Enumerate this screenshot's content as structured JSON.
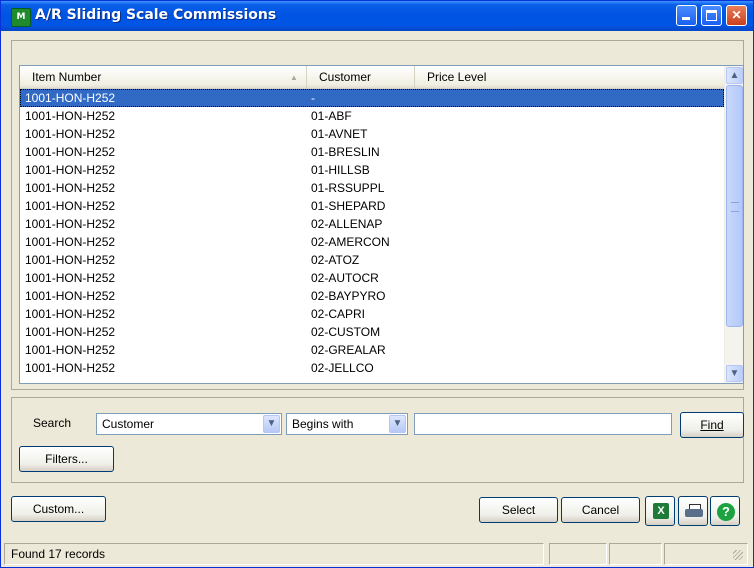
{
  "window": {
    "title": "A/R Sliding Scale Commissions",
    "icon": "mas90-app-icon"
  },
  "grid": {
    "columns": [
      "Item Number",
      "Customer",
      "Price Level"
    ],
    "rows": [
      {
        "item": "1001-HON-H252",
        "customer": "-",
        "selected": true
      },
      {
        "item": "1001-HON-H252",
        "customer": "01-ABF"
      },
      {
        "item": "1001-HON-H252",
        "customer": "01-AVNET"
      },
      {
        "item": "1001-HON-H252",
        "customer": "01-BRESLIN"
      },
      {
        "item": "1001-HON-H252",
        "customer": "01-HILLSB"
      },
      {
        "item": "1001-HON-H252",
        "customer": "01-RSSUPPL"
      },
      {
        "item": "1001-HON-H252",
        "customer": "01-SHEPARD"
      },
      {
        "item": "1001-HON-H252",
        "customer": "02-ALLENAP"
      },
      {
        "item": "1001-HON-H252",
        "customer": "02-AMERCON"
      },
      {
        "item": "1001-HON-H252",
        "customer": "02-ATOZ"
      },
      {
        "item": "1001-HON-H252",
        "customer": "02-AUTOCR"
      },
      {
        "item": "1001-HON-H252",
        "customer": "02-BAYPYRO"
      },
      {
        "item": "1001-HON-H252",
        "customer": "02-CAPRI"
      },
      {
        "item": "1001-HON-H252",
        "customer": "02-CUSTOM"
      },
      {
        "item": "1001-HON-H252",
        "customer": "02-GREALAR"
      },
      {
        "item": "1001-HON-H252",
        "customer": "02-JELLCO"
      }
    ]
  },
  "search": {
    "label": "Search",
    "field_value": "Customer",
    "operator_value": "Begins with",
    "text_value": "",
    "find_label": "Find",
    "filters_label": "Filters..."
  },
  "footer": {
    "custom_label": "Custom...",
    "select_label": "Select",
    "cancel_label": "Cancel"
  },
  "status": {
    "text": "Found 17 records"
  },
  "colors": {
    "titlebar": "#0054e3",
    "selection": "#316ac5",
    "window_bg": "#ece9d8"
  }
}
